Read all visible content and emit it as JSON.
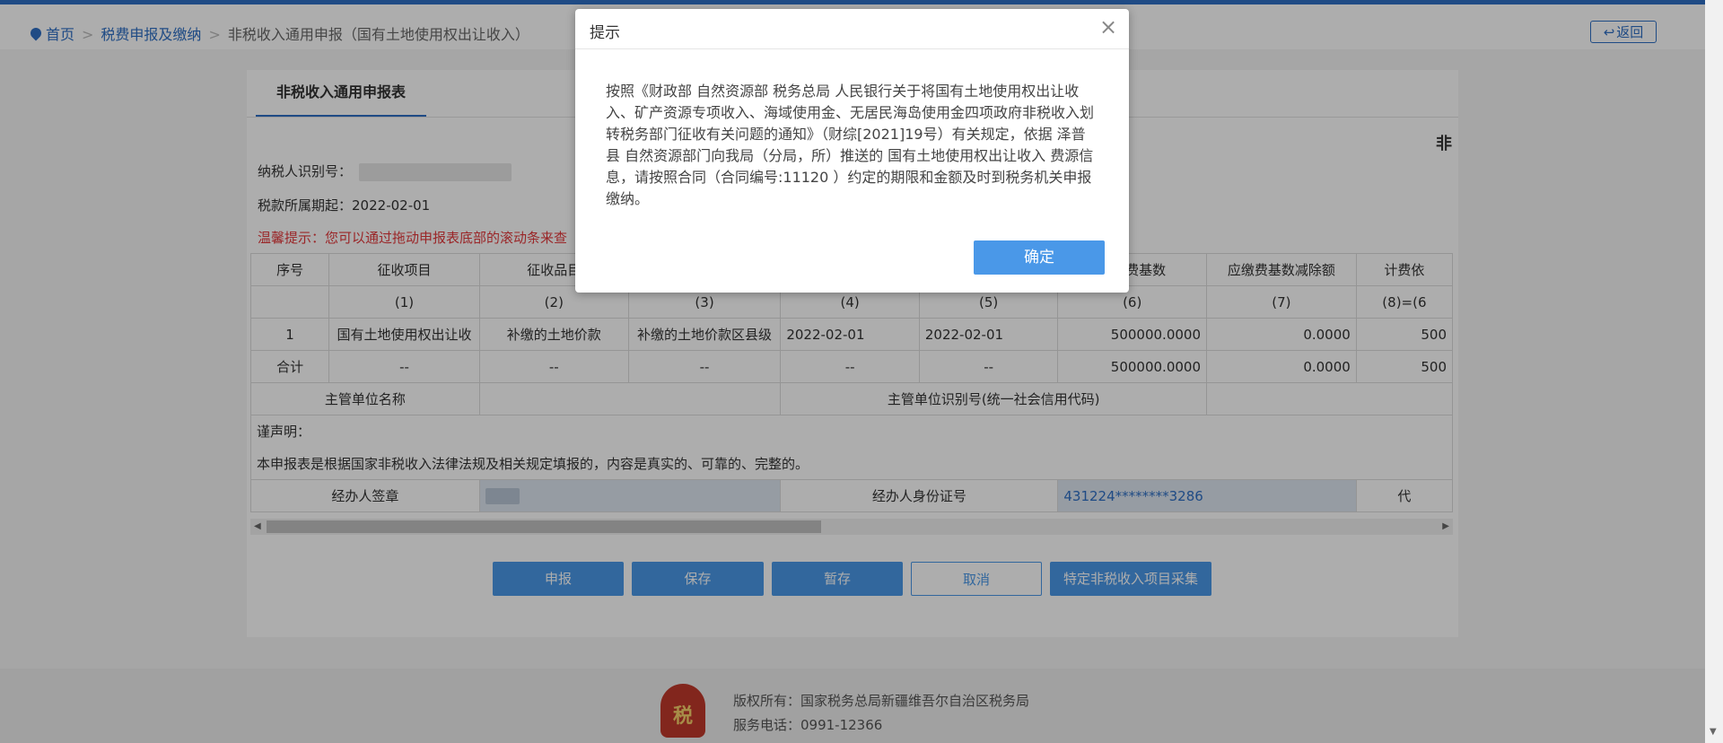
{
  "breadcrumb": {
    "home": "首页",
    "level1": "税费申报及缴纳",
    "level2": "非税收入通用申报（国有土地使用权出让收入）"
  },
  "back_button": "返回",
  "tab": "非税收入通用申报表",
  "doc_title": "非",
  "form": {
    "taxpayer_id_label": "纳税人识别号：",
    "period_label": "税款所属期起：",
    "period_value": "2022-02-01",
    "tip": "温馨提示：您可以通过拖动申报表底部的滚动条来查"
  },
  "table": {
    "headers": [
      "序号",
      "征收项目",
      "征收品目",
      "",
      "",
      "",
      "应缴费基数",
      "应缴费基数减除额",
      "计费依"
    ],
    "index_row": [
      "",
      "(1)",
      "(2)",
      "(3)",
      "(4)",
      "(5)",
      "(6)",
      "(7)",
      "(8)=(6"
    ],
    "data_row": [
      "1",
      "国有土地使用权出让收",
      "补缴的土地价款",
      "补缴的土地价款区县级",
      "2022-02-01",
      "2022-02-01",
      "500000.0000",
      "0.0000",
      "500"
    ],
    "total_row": [
      "合计",
      "--",
      "--",
      "--",
      "--",
      "--",
      "500000.0000",
      "0.0000",
      "500"
    ],
    "org_name_label": "主管单位名称",
    "org_id_label": "主管单位识别号(统一社会信用代码)",
    "declare_label": "谨声明：",
    "declare_text": "本申报表是根据国家非税收入法律法规及相关规定填报的，内容是真实的、可靠的、完整的。",
    "agent_sign_label": "经办人签章",
    "agent_id_label": "经办人身份证号",
    "agent_id_value": "431224********3286",
    "agent_extra": "代"
  },
  "buttons": {
    "declare": "申报",
    "save": "保存",
    "temp_save": "暂存",
    "cancel": "取消",
    "special": "特定非税收入项目采集"
  },
  "footer": {
    "logo_text": "税",
    "copyright": "版权所有：国家税务总局新疆维吾尔自治区税务局",
    "phone": "服务电话：0991-12366"
  },
  "dialog": {
    "title": "提示",
    "message": "按照《财政部 自然资源部 税务总局 人民银行关于将国有土地使用权出让收入、矿产资源专项收入、海域使用金、无居民海岛使用金四项政府非税收入划转税务部门征收有关问题的通知》（财综[2021]19号）有关规定，依据 泽普县 自然资源部门向我局（分局，所）推送的 国有土地使用权出让收入 费源信息，请按照合同（合同编号:11120 ）约定的期限和金额及时到税务机关申报缴纳。",
    "ok": "确定"
  },
  "colors": {
    "primary": "#4a98e8",
    "link": "#2f6fc4",
    "warning": "#e4393c"
  }
}
